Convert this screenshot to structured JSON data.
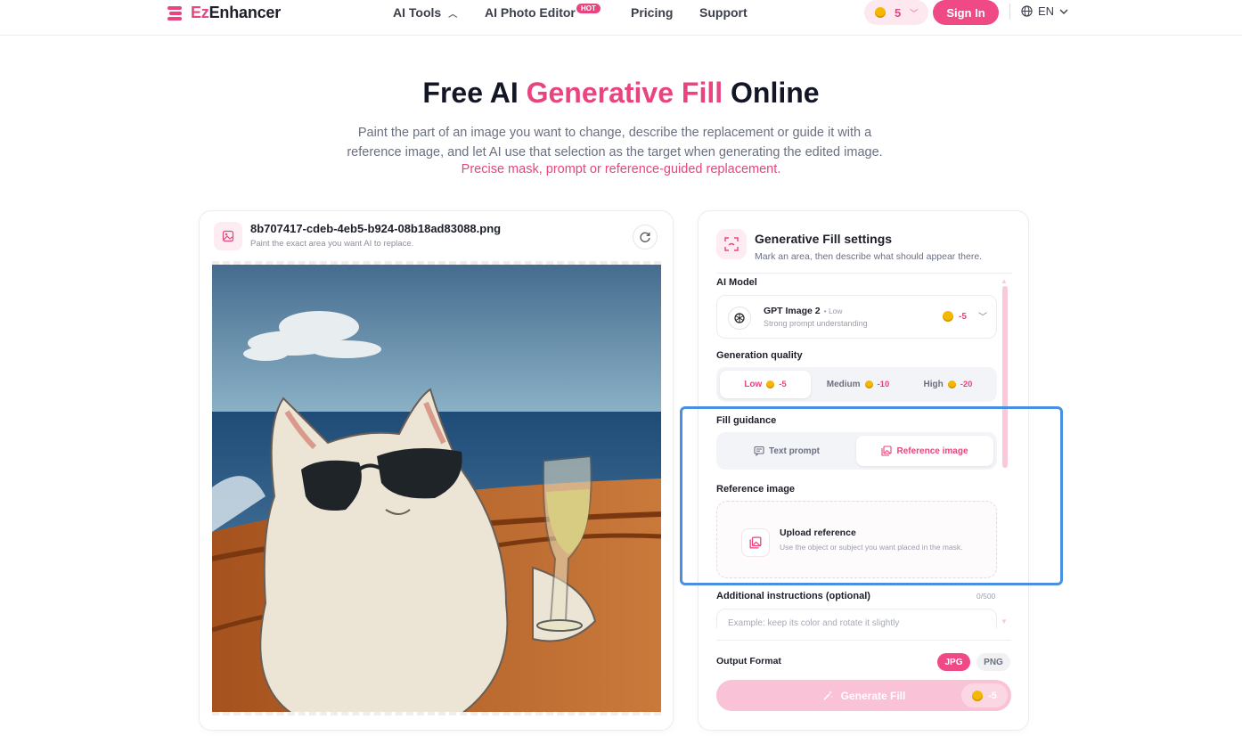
{
  "header": {
    "brand_prefix": "Ez",
    "brand_rest": "Enhancer",
    "nav": {
      "ai_tools": "AI Tools",
      "photo_editor": "AI Photo Editor",
      "hot_badge": "HOT",
      "pricing": "Pricing",
      "support": "Support"
    },
    "credits": "5",
    "sign_in": "Sign In",
    "language": "EN"
  },
  "hero": {
    "title_part1": "Free AI ",
    "title_highlight": "Generative Fill",
    "title_part2": " Online",
    "description": "Paint the part of an image you want to change, describe the replacement or guide it with a reference image, and let AI use that selection as the target when generating the edited image.",
    "tagline": "Precise mask, prompt or reference-guided replacement."
  },
  "editor": {
    "file_name": "8b707417-cdeb-4eb5-b924-08b18ad83088.png",
    "hint": "Paint the exact area you want AI to replace."
  },
  "settings": {
    "title": "Generative Fill settings",
    "subtitle": "Mark an area, then describe what should appear there.",
    "ai_model_label": "AI Model",
    "model": {
      "name": "GPT Image 2",
      "tier": "• Low",
      "description": "Strong prompt understanding",
      "cost": "-5"
    },
    "quality_label": "Generation quality",
    "quality_options": [
      {
        "label": "Low",
        "cost": "-5"
      },
      {
        "label": "Medium",
        "cost": "-10"
      },
      {
        "label": "High",
        "cost": "-20"
      }
    ],
    "fill_guidance_label": "Fill guidance",
    "guidance_options": {
      "text": "Text prompt",
      "reference": "Reference image"
    },
    "reference_label": "Reference image",
    "upload_title": "Upload reference",
    "upload_subtitle": "Use the object or subject you want placed in the mask.",
    "instructions_label": "Additional instructions (optional)",
    "instructions_count": "0/500",
    "instructions_placeholder": "Example: keep its color and rotate it slightly",
    "output_format_label": "Output Format",
    "formats": {
      "jpg": "JPG",
      "png": "PNG"
    },
    "generate_label": "Generate Fill",
    "generate_cost": "-5"
  },
  "colors": {
    "accent": "#e8447f",
    "highlight": "#4a90e2"
  }
}
